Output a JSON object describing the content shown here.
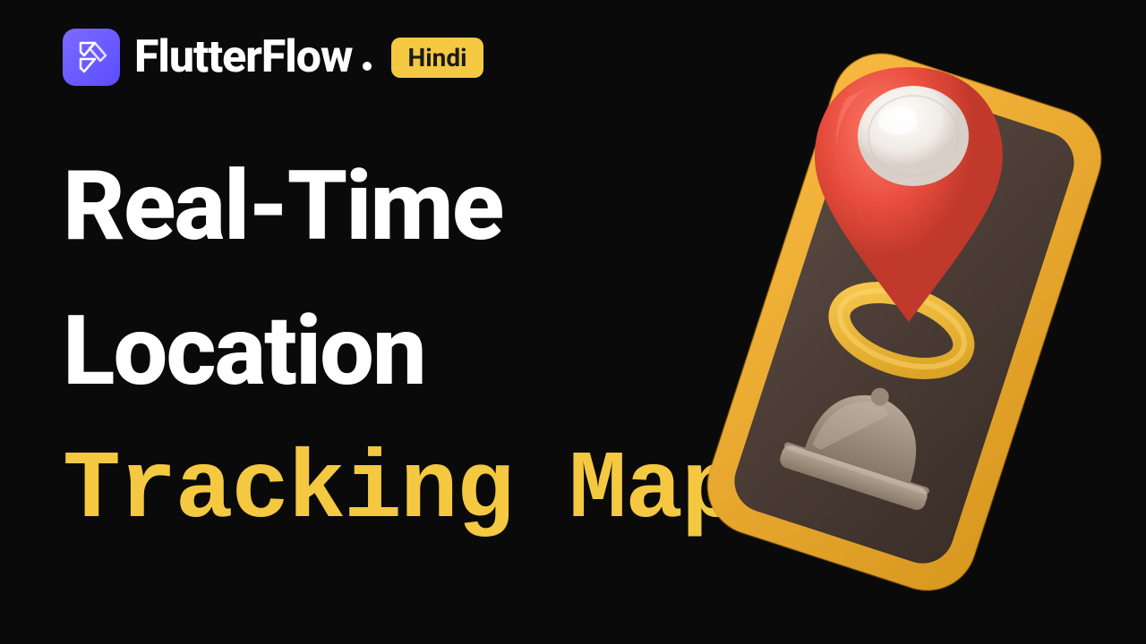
{
  "header": {
    "brand": "FlutterFlow",
    "badge": "Hindi"
  },
  "title": {
    "line1": "Real-Time",
    "line2": "Location",
    "subtitle": "Tracking Map"
  },
  "colors": {
    "accent": "#f5c842",
    "logo": "#5b4cff",
    "pin": "#e74c3c"
  }
}
